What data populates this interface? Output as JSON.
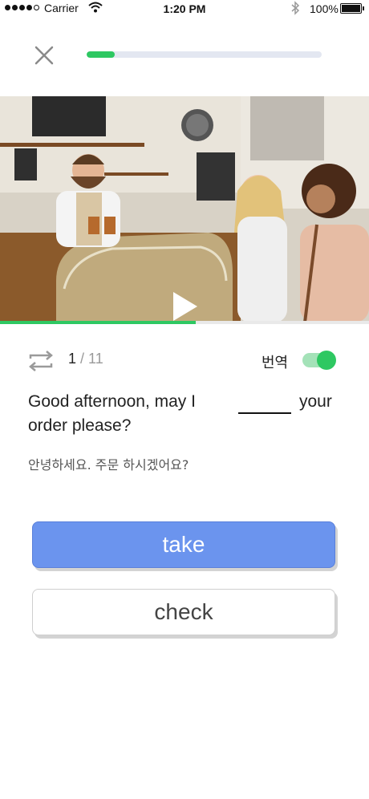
{
  "status_bar": {
    "carrier": "Carrier",
    "time": "1:20 PM",
    "battery": "100%",
    "signal_dots_filled": 4,
    "signal_dots_total": 5
  },
  "lesson_progress": 0.12,
  "video": {
    "progress": 0.53
  },
  "controls": {
    "current": "1",
    "total": "/ 11",
    "translate_label": "번역",
    "translate_on": true
  },
  "question": {
    "before_blank": "Good afternoon, may I order please?",
    "after_blank": "your",
    "translation": "안녕하세요. 주문 하시겠어요?"
  },
  "answers": [
    {
      "label": "take"
    },
    {
      "label": "check"
    }
  ],
  "colors": {
    "accent_green": "#2ec862",
    "primary_blue": "#6b94ee",
    "progress_track": "#e3e7f1"
  }
}
